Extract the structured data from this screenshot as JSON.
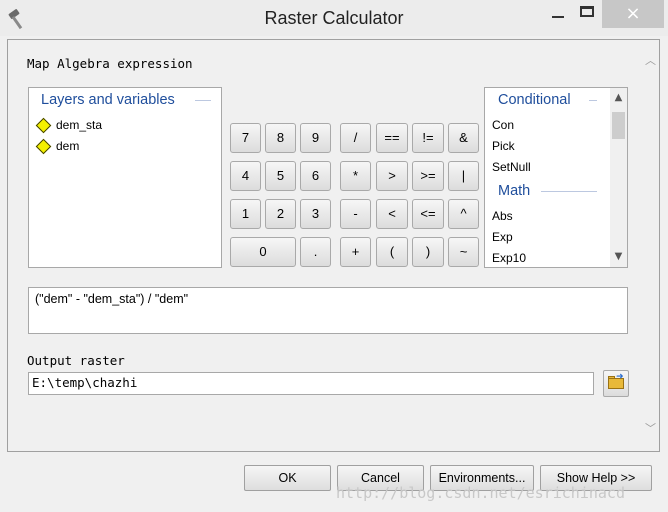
{
  "window": {
    "title": "Raster Calculator",
    "app_icon": "hammer-icon",
    "controls": {
      "minimize": "minimize-icon",
      "maximize": "maximize-icon",
      "close": "×"
    }
  },
  "labels": {
    "map_algebra": "Map Algebra expression",
    "output_raster": "Output raster"
  },
  "layers_panel": {
    "title": "Layers and variables",
    "items": [
      {
        "label": "dem_sta",
        "icon": "raster-layer-icon"
      },
      {
        "label": "dem",
        "icon": "raster-layer-icon"
      }
    ]
  },
  "calculator": {
    "row1": [
      "7",
      "8",
      "9",
      "/",
      "==",
      "!=",
      "&"
    ],
    "row2": [
      "4",
      "5",
      "6",
      "*",
      ">",
      ">=",
      "|"
    ],
    "row3": [
      "1",
      "2",
      "3",
      "-",
      "<",
      "<=",
      "^"
    ],
    "row4": [
      "0",
      ".",
      "+",
      "(",
      ")",
      "~"
    ]
  },
  "functions_panel": {
    "groups": [
      {
        "title": "Conditional",
        "items": [
          "Con",
          "Pick",
          "SetNull"
        ]
      },
      {
        "title": "Math",
        "items": [
          "Abs",
          "Exp",
          "Exp10"
        ]
      }
    ]
  },
  "expression": "(\"dem\" - \"dem_sta\") / \"dem\"",
  "output_raster_value": "E:\\temp\\chazhi",
  "buttons": {
    "ok": "OK",
    "cancel": "Cancel",
    "environments": "Environments...",
    "show_help": "Show Help >>"
  },
  "watermark": "http://blog.csdn.net/esrichinacd",
  "colors": {
    "group_title": "#1f4e9c",
    "layer_icon": "#f4f000"
  }
}
